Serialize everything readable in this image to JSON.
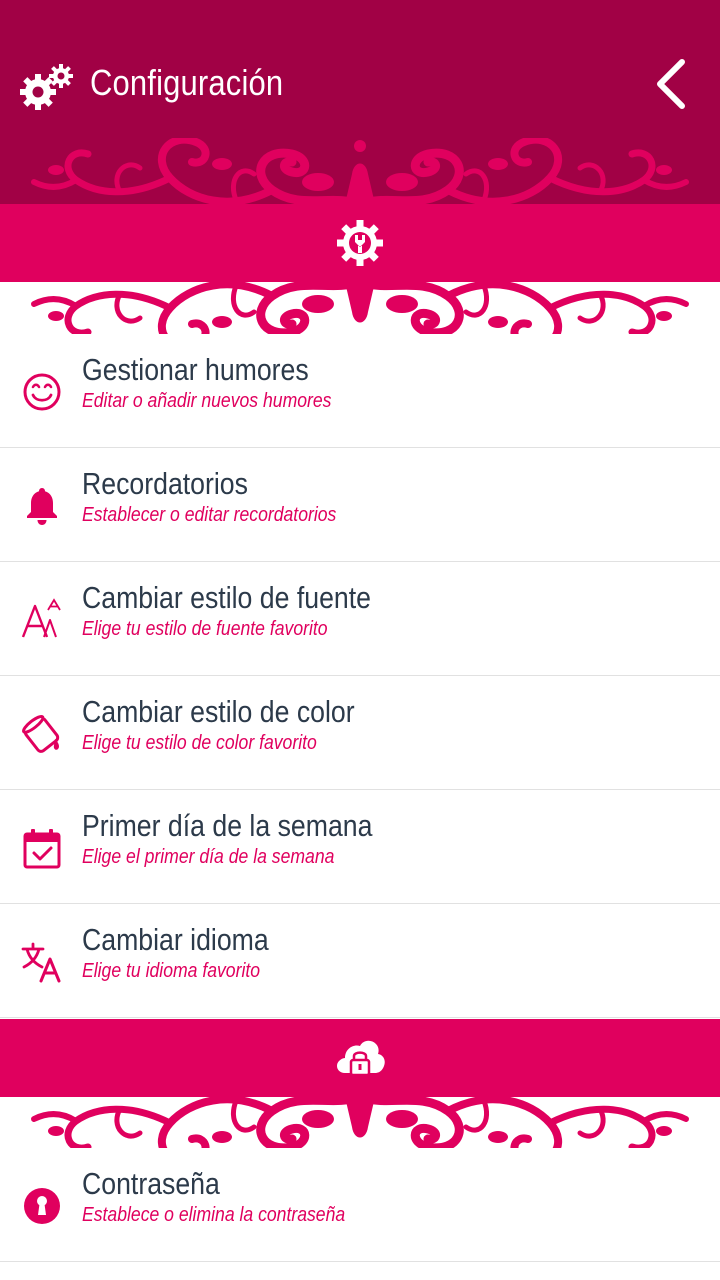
{
  "header": {
    "title": "Configuración",
    "icon": "gears-icon",
    "back_icon": "chevron-left-icon"
  },
  "colors": {
    "header_bg": "#a10145",
    "accent": "#e0005e",
    "title_text": "#2c3a4a",
    "divider": "#e1e1e1"
  },
  "sections": [
    {
      "icon": "gear-wrench-icon",
      "items": [
        {
          "title": "Gestionar humores",
          "subtitle": "Editar o añadir nuevos humores",
          "icon": "wink-face-icon"
        },
        {
          "title": "Recordatorios",
          "subtitle": "Establecer o editar recordatorios",
          "icon": "bell-icon"
        },
        {
          "title": "Cambiar estilo de fuente",
          "subtitle": "Elige tu estilo de fuente favorito",
          "icon": "font-style-icon"
        },
        {
          "title": "Cambiar estilo de color",
          "subtitle": "Elige tu estilo de color favorito",
          "icon": "paint-bucket-icon"
        },
        {
          "title": "Primer día de la semana",
          "subtitle": "Elige el primer día de la semana",
          "icon": "calendar-check-icon"
        },
        {
          "title": "Cambiar idioma",
          "subtitle": "Elige tu idioma favorito",
          "icon": "translate-icon"
        }
      ]
    },
    {
      "icon": "cloud-lock-icon",
      "items": [
        {
          "title": "Contraseña",
          "subtitle": "Establece o elimina la contraseña",
          "icon": "keyhole-icon"
        }
      ]
    }
  ]
}
